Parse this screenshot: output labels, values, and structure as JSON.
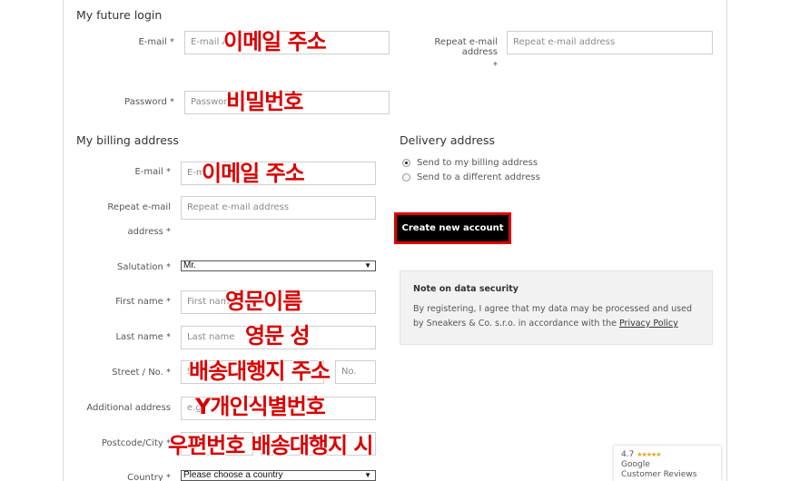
{
  "login": {
    "title": "My future login",
    "email_label": "E-mail *",
    "email_placeholder": "E-mail A",
    "repeat_email_label": "Repeat e-mail address",
    "repeat_email_star": "*",
    "repeat_email_placeholder": "Repeat e-mail address",
    "password_label": "Password *",
    "password_placeholder": "Password"
  },
  "billing": {
    "title": "My billing address",
    "email_label": "E-mail *",
    "email_placeholder": "E-m",
    "repeat_email_label_line1": "Repeat e-mail",
    "repeat_email_label_line2": "address *",
    "repeat_email_placeholder": "Repeat e-mail address",
    "salutation_label": "Salutation *",
    "salutation_value": "Mr.",
    "first_name_label": "First name *",
    "first_name_placeholder": "First name",
    "last_name_label": "Last name *",
    "last_name_placeholder": "Last name",
    "street_label": "Street / No. *",
    "street_placeholder": "S",
    "no_placeholder": "No.",
    "additional_label": "Additional address",
    "additional_placeholder": "e.g.",
    "postcode_label": "Postcode/City *",
    "country_label": "Country *",
    "country_value": "Please choose a country"
  },
  "delivery": {
    "title": "Delivery address",
    "option1": "Send to my billing address",
    "option2": "Send to a different address",
    "selected": "Send to my billing address"
  },
  "create_button": "Create new account",
  "note": {
    "title": "Note on data security",
    "text": "By registering, I agree that my data may be processed and used by Sneakers & Co. s.r.o. in accordance with the",
    "link": "Privacy Policy"
  },
  "overlays": {
    "login_email": "이메일 주소",
    "login_password": "비밀번호",
    "billing_email": "이메일 주소",
    "first_name": "영문이름",
    "last_name": "영문 성",
    "street": "배송대행지 주소",
    "additional": "Y개인식별번호",
    "postcode": "우편번호 배송대행지 시"
  },
  "google_badge": {
    "rating": "4.7",
    "stars": "★★★★★",
    "line1": "Google",
    "line2": "Customer Reviews"
  },
  "colors": {
    "annotation_red": "#d90000",
    "button_bg": "#000000",
    "button_border": "#e00000",
    "note_bg": "#f2f2f2"
  }
}
